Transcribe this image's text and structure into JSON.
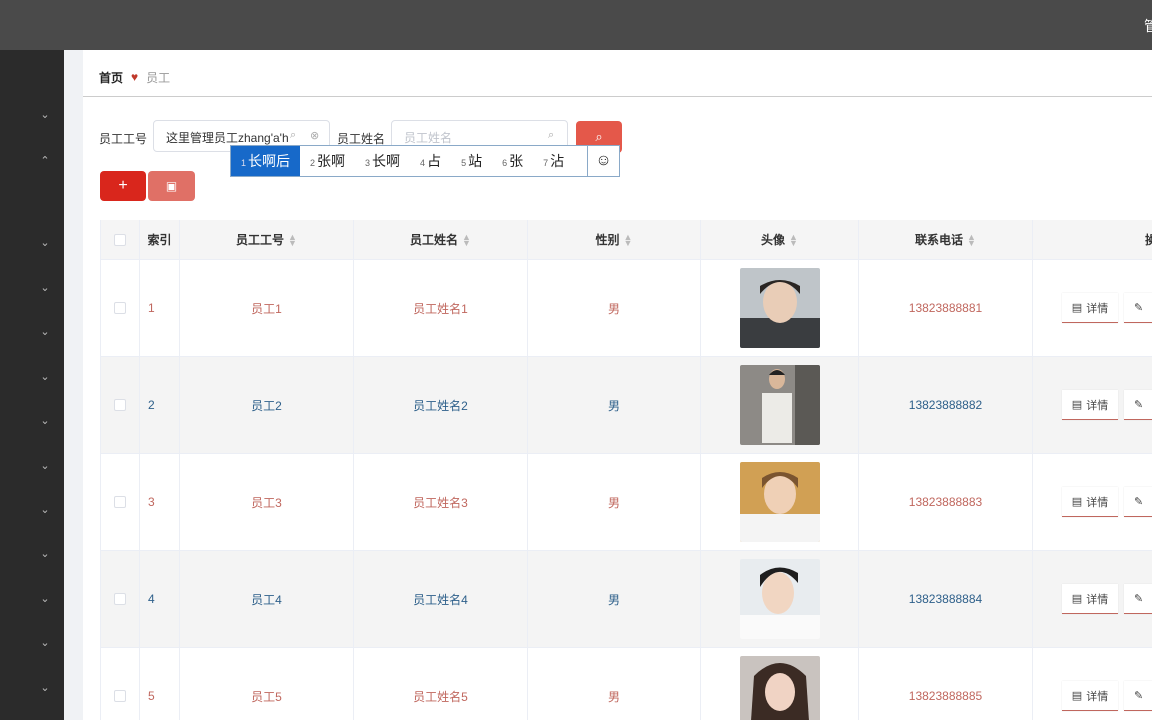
{
  "topbar": {
    "right_text": "管"
  },
  "breadcrumb": {
    "home": "首页",
    "current": "员工"
  },
  "search": {
    "id_label": "员工工号",
    "id_value": "这里管理员工zhang'a'h",
    "name_label": "员工姓名",
    "name_placeholder": "员工姓名"
  },
  "ime": {
    "candidates": [
      {
        "num": "1",
        "text": "长啊后"
      },
      {
        "num": "2",
        "text": "张啊"
      },
      {
        "num": "3",
        "text": "长啊"
      },
      {
        "num": "4",
        "text": "占"
      },
      {
        "num": "5",
        "text": "站"
      },
      {
        "num": "6",
        "text": "张"
      },
      {
        "num": "7",
        "text": "沾"
      }
    ],
    "emoji": "☺"
  },
  "toolbar": {
    "add_label": "+",
    "delete_label": "🗑"
  },
  "table": {
    "headers": {
      "index": "索引",
      "emp_id": "员工工号",
      "emp_name": "员工姓名",
      "gender": "性别",
      "avatar": "头像",
      "phone": "联系电话",
      "actions": "操作"
    },
    "detail_label": "详情",
    "edit_label": "编辑",
    "rows": [
      {
        "index": "1",
        "emp_id": "员工1",
        "emp_name": "员工姓名1",
        "gender": "男",
        "phone": "13823888881"
      },
      {
        "index": "2",
        "emp_id": "员工2",
        "emp_name": "员工姓名2",
        "gender": "男",
        "phone": "13823888882"
      },
      {
        "index": "3",
        "emp_id": "员工3",
        "emp_name": "员工姓名3",
        "gender": "男",
        "phone": "13823888883"
      },
      {
        "index": "4",
        "emp_id": "员工4",
        "emp_name": "员工姓名4",
        "gender": "男",
        "phone": "13823888884"
      },
      {
        "index": "5",
        "emp_id": "员工5",
        "emp_name": "员工姓名5",
        "gender": "男",
        "phone": "13823888885"
      }
    ]
  },
  "colors": {
    "accent": "#e4584a",
    "add": "#d9261c",
    "row_odd_text": "#c0675e",
    "row_even_text": "#2d5f8a",
    "ime_selected": "#1769c9"
  }
}
